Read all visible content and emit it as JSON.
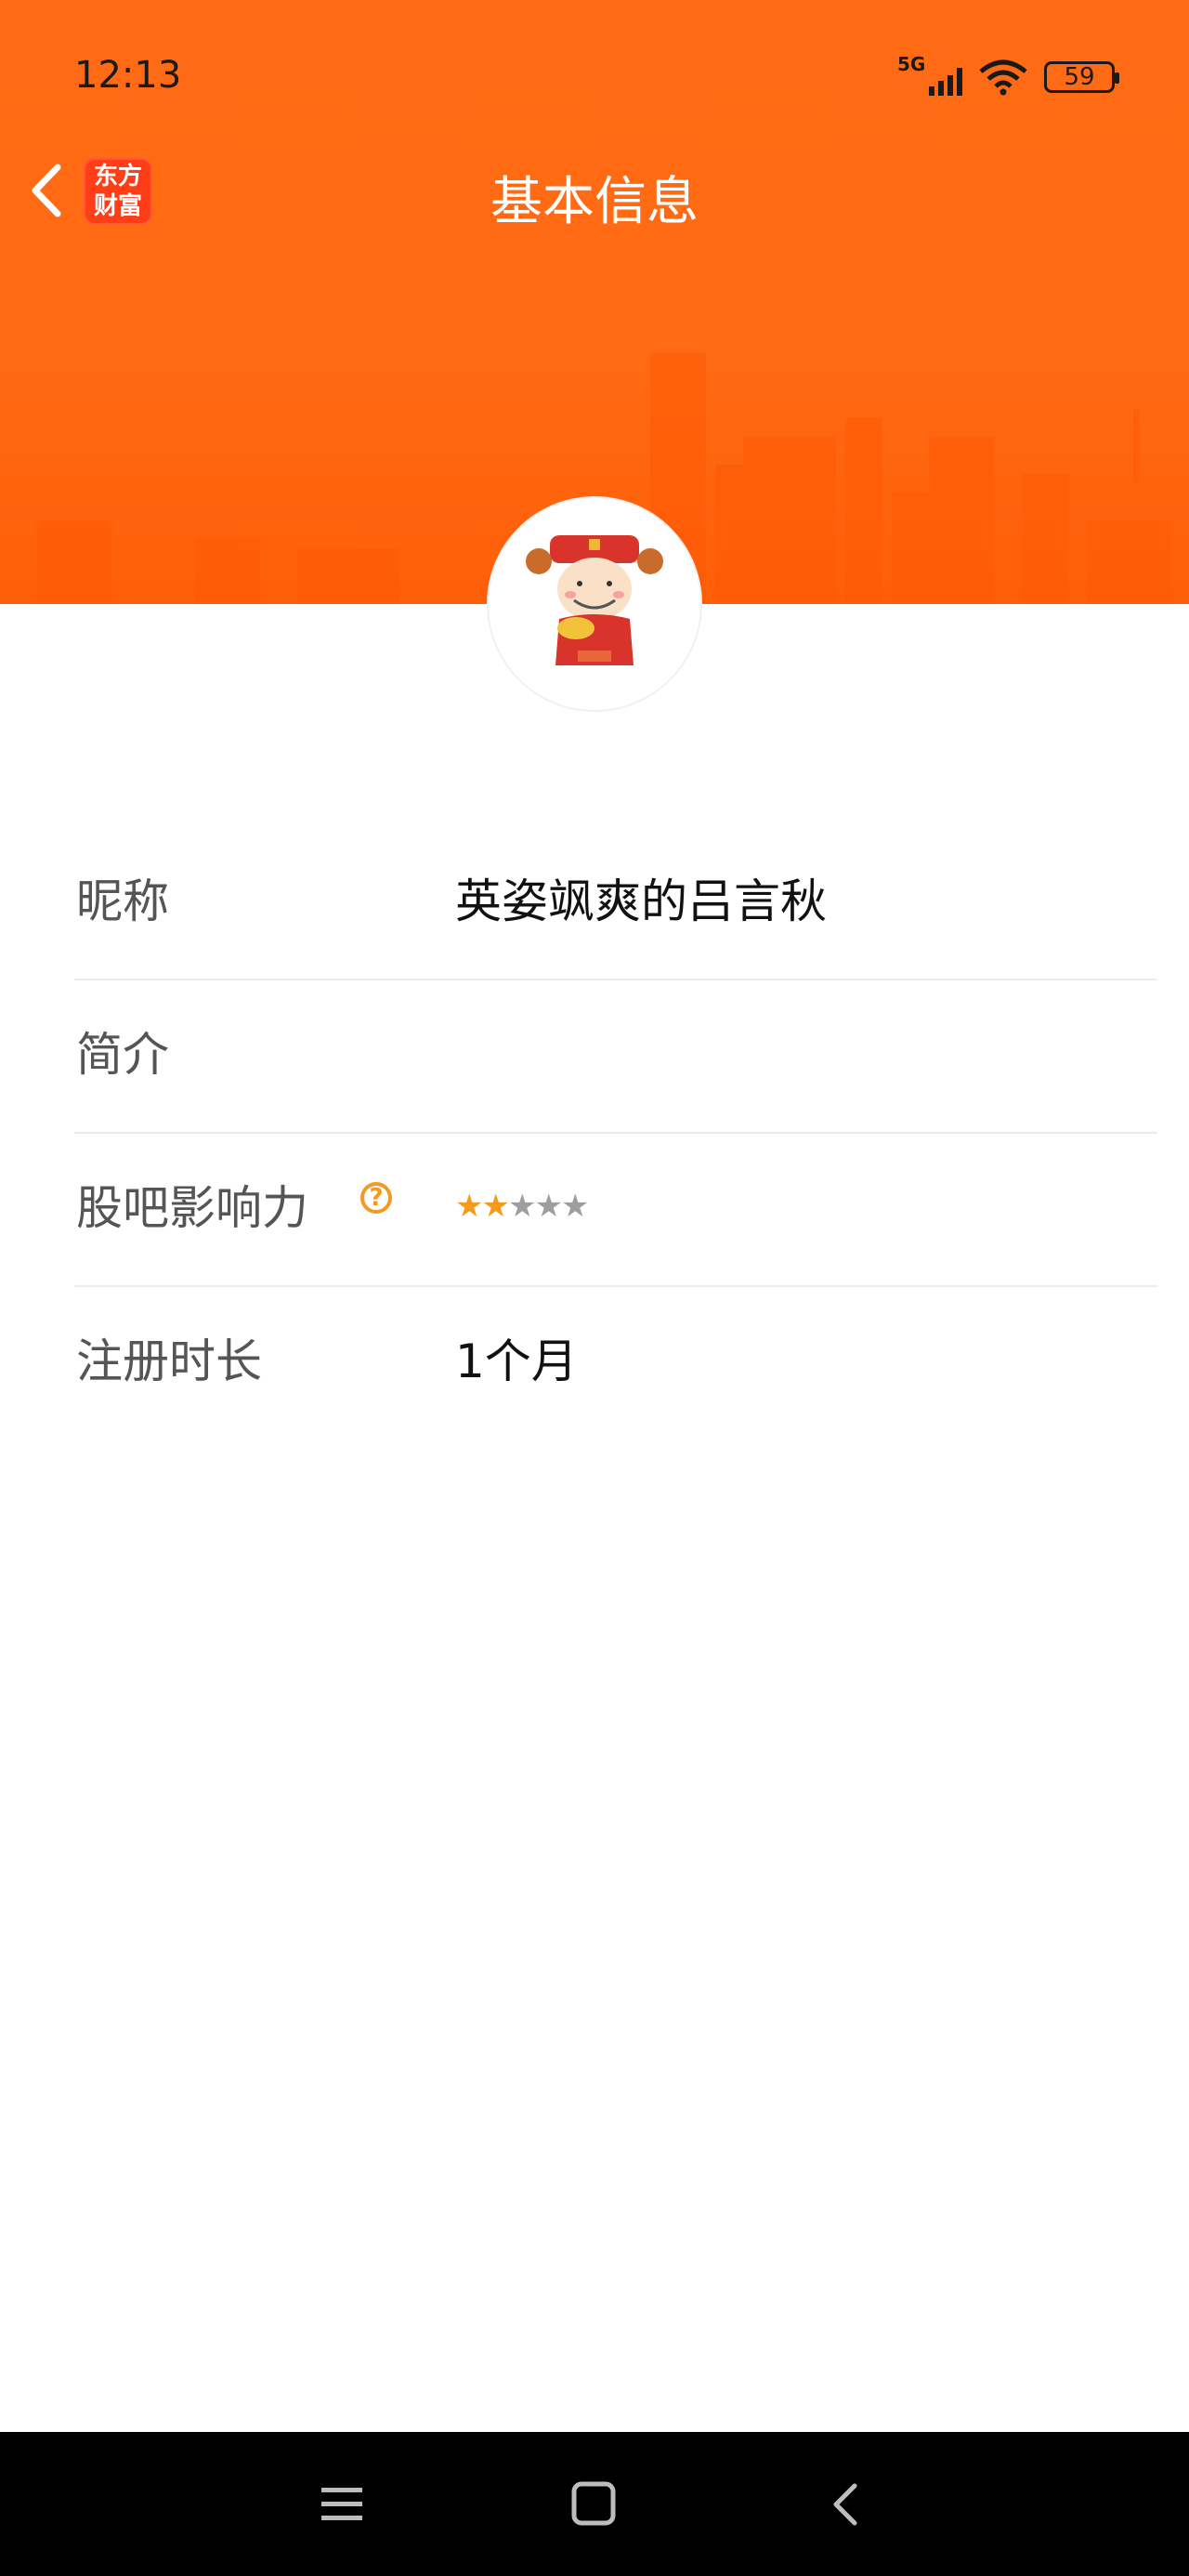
{
  "status_bar": {
    "time": "12:13",
    "network": "5G",
    "battery": "59"
  },
  "nav": {
    "title": "基本信息",
    "logo_line1": "东方",
    "logo_line2": "财富"
  },
  "rows": [
    {
      "label": "昵称",
      "value": "英姿飒爽的吕言秋"
    },
    {
      "label": "简介",
      "value": ""
    },
    {
      "label": "股吧影响力",
      "help": "?",
      "stars_filled": 2,
      "stars_total": 5
    },
    {
      "label": "注册时长",
      "value": "1个月"
    }
  ],
  "colors": {
    "header": "#ff6b14",
    "star_on": "#f59a1f",
    "star_off": "#9e9e9e",
    "help": "#f39a26"
  },
  "icons": [
    "back-arrow-icon",
    "app-logo-icon",
    "signal-icon",
    "wifi-icon",
    "battery-icon",
    "help-icon",
    "star-icon",
    "menu-icon",
    "home-icon",
    "back-icon"
  ]
}
